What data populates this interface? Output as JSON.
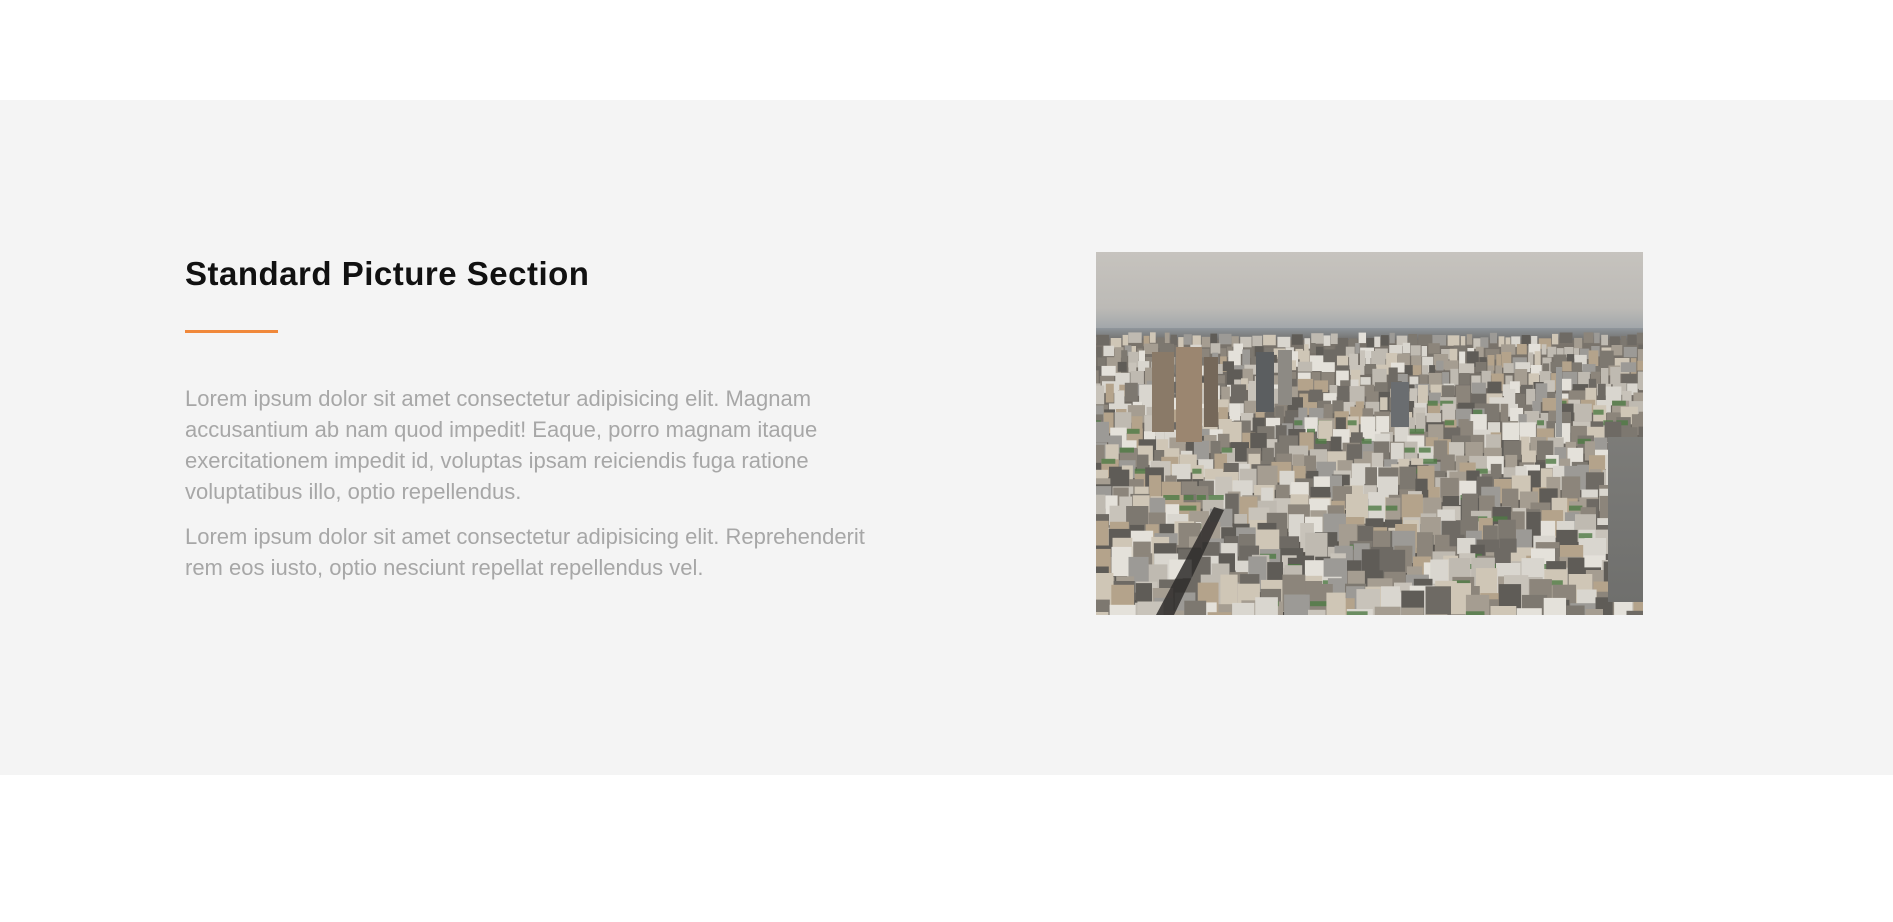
{
  "section": {
    "title": "Standard Picture Section",
    "paragraphs": [
      "Lorem ipsum dolor sit amet consectetur adipisicing elit. Magnam accusantium ab nam quod impedit! Eaque, porro magnam itaque exercitationem impedit id, voluptas ipsam reiciendis fuga ratione voluptatibus illo, optio repellendus.",
      "Lorem ipsum dolor sit amet consectetur adipisicing elit. Reprehenderit rem eos iusto, optio nesciunt repellat repellendus vel."
    ],
    "picture": {
      "subject": "aerial-city-skyline"
    }
  },
  "colors": {
    "accent": "#f0883a",
    "background": "#f4f4f4",
    "title": "#111111",
    "body_text": "#a7a7a7"
  }
}
